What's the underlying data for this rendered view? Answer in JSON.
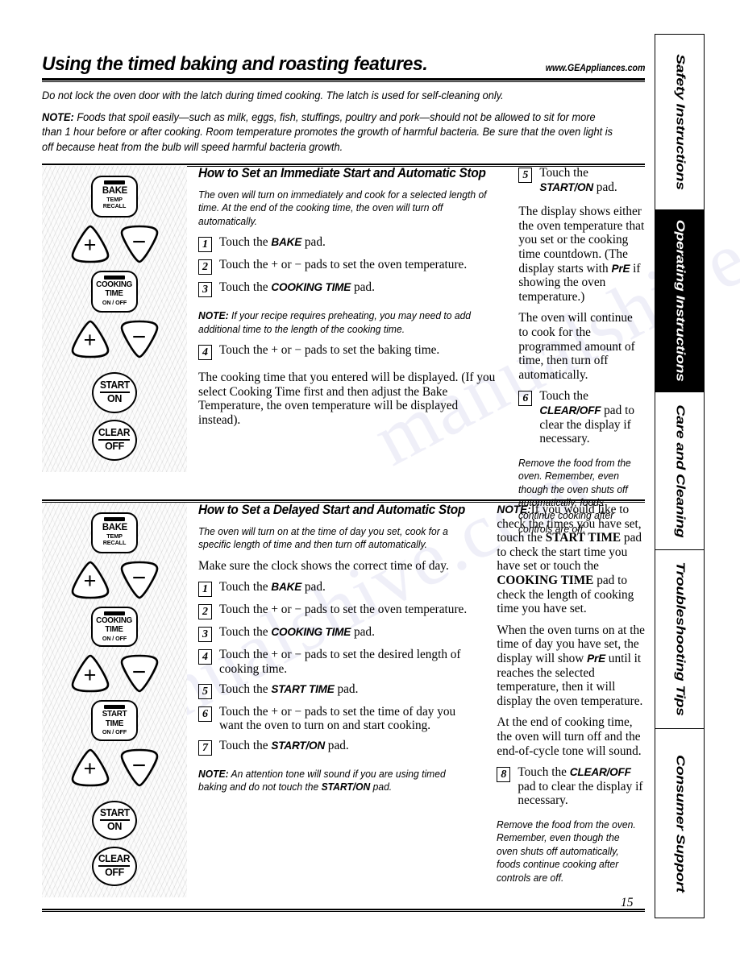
{
  "header": {
    "title": "Using the timed baking and roasting features.",
    "site_url": "www.GEAppliances.com"
  },
  "intro": {
    "line1": "Do not lock the oven door with the latch during timed cooking. The latch is used for self-cleaning only.",
    "note_label": "NOTE:",
    "note_text": " Foods that spoil easily—such as milk, eggs, fish, stuffings, poultry and pork—should not be allowed to sit for more than 1 hour before or after cooking. Room temperature promotes the growth of harmful bacteria. Be sure that the oven light is off because heat from the bulb will speed harmful bacteria growth."
  },
  "control_pads": {
    "bake": {
      "main": "BAKE",
      "sub_line1": "TEMP",
      "sub_line2": "RECALL"
    },
    "cooking_time": {
      "main_line1": "COOKING",
      "main_line2": "TIME",
      "sub": "ON / OFF"
    },
    "start_time": {
      "main_line1": "START",
      "main_line2": "TIME",
      "sub": "ON / OFF"
    },
    "start_on": {
      "top": "START",
      "bottom": "ON"
    },
    "clear_off": {
      "top": "CLEAR",
      "bottom": "OFF"
    },
    "plus": "+",
    "minus": "−"
  },
  "section1": {
    "heading": "How to Set an Immediate Start and Automatic Stop",
    "lead": "The oven will turn on immediately and cook for a selected length of time. At the end of the cooking time, the oven will turn off automatically.",
    "steps": [
      {
        "num": "1",
        "pre": "Touch the ",
        "bold": "BAKE",
        "post": " pad."
      },
      {
        "num": "2",
        "pre": "Touch the + or − pads to set the oven temperature.",
        "bold": "",
        "post": ""
      },
      {
        "num": "3",
        "pre": "Touch the ",
        "bold": "COOKING TIME",
        "post": " pad."
      },
      {
        "num": "4",
        "pre": "Touch the + or − pads to set the baking time.",
        "bold": "",
        "post": ""
      }
    ],
    "note_label": "NOTE:",
    "note_text": " If your recipe requires preheating, you may need to add additional time to the length of the cooking time.",
    "para_after": "The cooking time that you entered will be displayed. (If you select Cooking Time first and then adjust the Bake Temperature, the oven temperature will be displayed instead).",
    "right_step5": {
      "num": "5",
      "pre": "Touch the ",
      "bold": "START/ON",
      "post": " pad."
    },
    "right_para1_a": "The display shows either the oven temperature that you set or the cooking time countdown.  (The display starts with ",
    "right_para1_bold": "PrE",
    "right_para1_b": " if showing the oven temperature.)",
    "right_para2": "The oven will continue to cook for the programmed amount of time, then turn off automatically.",
    "right_step6": {
      "num": "6",
      "pre": "Touch the ",
      "bold": "CLEAR/OFF",
      "post": " pad to clear the display if necessary."
    },
    "right_closing": "Remove the food from the oven. Remember, even though the oven shuts off automatically, foods continue cooking after controls are off."
  },
  "section2": {
    "heading": "How to Set a Delayed Start and Automatic Stop",
    "lead": "The oven will turn on at the time of day you set, cook for a specific length of time and then turn off automatically.",
    "clock_note": "Make sure the clock shows the correct time of day.",
    "steps": [
      {
        "num": "1",
        "pre": "Touch the ",
        "bold": "BAKE",
        "post": " pad."
      },
      {
        "num": "2",
        "pre": "Touch the + or − pads to set the oven temperature.",
        "bold": "",
        "post": ""
      },
      {
        "num": "3",
        "pre": "Touch the ",
        "bold": "COOKING TIME",
        "post": " pad."
      },
      {
        "num": "4",
        "pre": "Touch the + or − pads to set the desired length of cooking time.",
        "bold": "",
        "post": ""
      },
      {
        "num": "5",
        "pre": "Touch the ",
        "bold": "START TIME",
        "post": " pad."
      },
      {
        "num": "6",
        "pre": "Touch the + or − pads to set the time of day you want the oven to turn on and start cooking.",
        "bold": "",
        "post": ""
      },
      {
        "num": "7",
        "pre": "Touch the ",
        "bold": "START/ON",
        "post": " pad."
      }
    ],
    "note_label": "NOTE:",
    "note_text_a": " An attention tone will sound if you are using timed baking and do not touch the ",
    "note_bold": "START/ON",
    "note_text_b": " pad.",
    "right_note_label": "NOTE:",
    "right_note_a": "If you would like to check the times you have set, touch the ",
    "right_note_bold1": "START TIME",
    "right_note_b": " pad to check the start time you have set or touch the ",
    "right_note_bold2": "COOKING TIME",
    "right_note_c": " pad to check the length of cooking time you have set.",
    "right_para1_a": "When the oven turns on at the time of day you have set, the display will show ",
    "right_para1_bold": "PrE",
    "right_para1_b": " until it reaches the selected temperature, then it will display the oven temperature.",
    "right_para2": "At the end of cooking time, the oven will turn off and the end-of-cycle tone will sound.",
    "right_step8": {
      "num": "8",
      "pre": "Touch the ",
      "bold": "CLEAR/OFF",
      "post": " pad to clear the display if necessary."
    },
    "right_closing": "Remove the food from the oven. Remember, even though the oven shuts off automatically, foods continue cooking after controls are off."
  },
  "sidebar": {
    "tabs": [
      {
        "label": "Safety Instructions",
        "active": false
      },
      {
        "label": "Operating Instructions",
        "active": true
      },
      {
        "label": "Care and Cleaning",
        "active": false
      },
      {
        "label": "Troubleshooting Tips",
        "active": false
      },
      {
        "label": "Consumer Support",
        "active": false
      }
    ]
  },
  "footer": {
    "page_number": "15"
  },
  "watermark": {
    "text1": "manualshive.com",
    "text2": "manualshive.com"
  }
}
